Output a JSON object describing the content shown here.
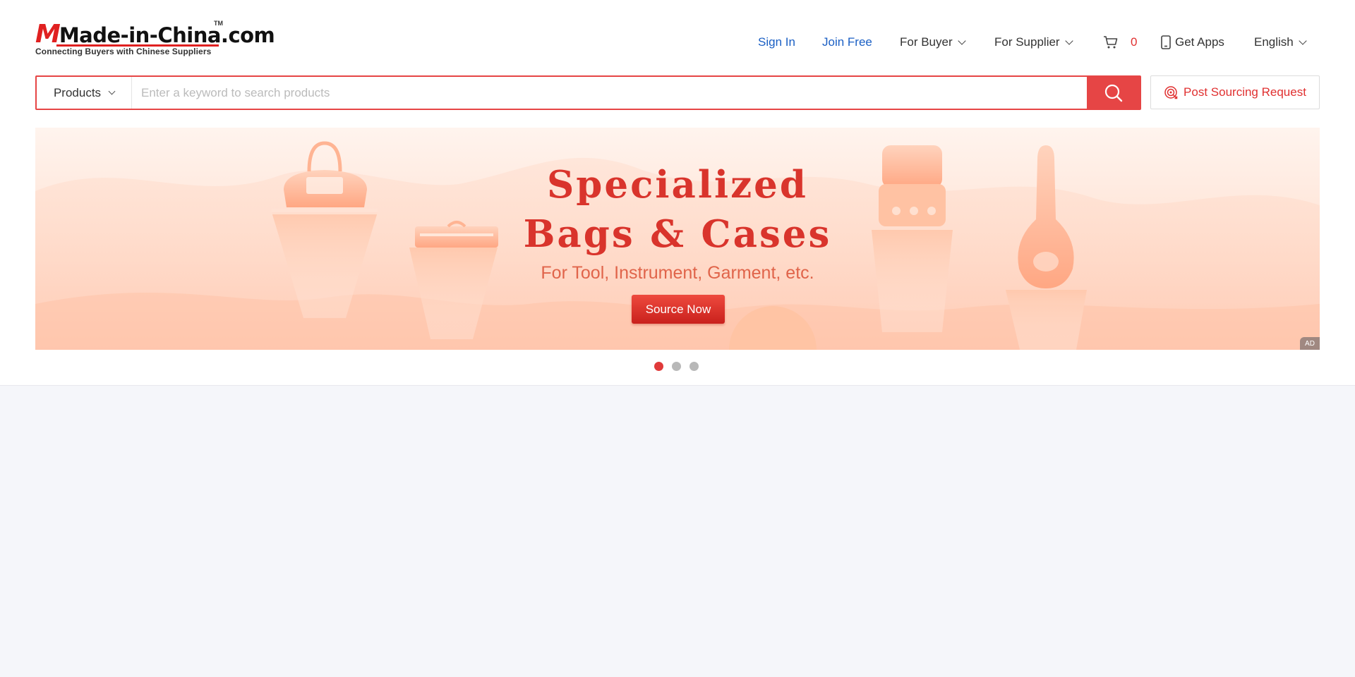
{
  "logo": {
    "brand": "Made-in-China.com",
    "tm": "TM",
    "tagline": "Connecting Buyers with Chinese Suppliers"
  },
  "nav": {
    "sign_in": "Sign In",
    "join_free": "Join Free",
    "for_buyer": "For Buyer",
    "for_supplier": "For Supplier",
    "cart_count": "0",
    "get_apps": "Get Apps",
    "language": "English"
  },
  "search": {
    "category": "Products",
    "placeholder": "Enter a keyword to search products",
    "value": ""
  },
  "post_sourcing": "Post Sourcing Request",
  "banner": {
    "title_line1": "Specialized",
    "title_line2": "Bags & Cases",
    "subtitle": "For Tool, Instrument, Garment, etc.",
    "cta": "Source Now",
    "ad_label": "AD",
    "slides": 3,
    "active_slide": 1
  },
  "colors": {
    "accent": "#e64545",
    "link": "#1a5fc4",
    "banner_text": "#d9342c",
    "page_bg": "#f5f6fa"
  }
}
